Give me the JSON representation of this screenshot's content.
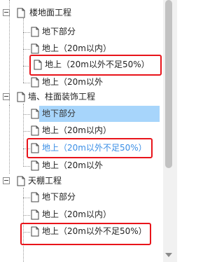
{
  "tree": {
    "groups": [
      {
        "title": "楼地面工程",
        "children": [
          "地下部分",
          "地上（20m以内）",
          "地上（20m以外不足50%）",
          "地上（20m以外"
        ]
      },
      {
        "title": "墙、柱面装饰工程",
        "children": [
          "地下部分",
          "地上（20m以内）",
          "地上（20m以外不足50%）",
          "地上（20m以外"
        ]
      },
      {
        "title": "天棚工程",
        "children": [
          "地下部分",
          "地上（20m以内）",
          "地上（20m以外不足50%）"
        ]
      }
    ]
  },
  "colors": {
    "highlight": "#a7d5fb",
    "link": "#3a8ee6",
    "annotation": "#e8141b"
  }
}
